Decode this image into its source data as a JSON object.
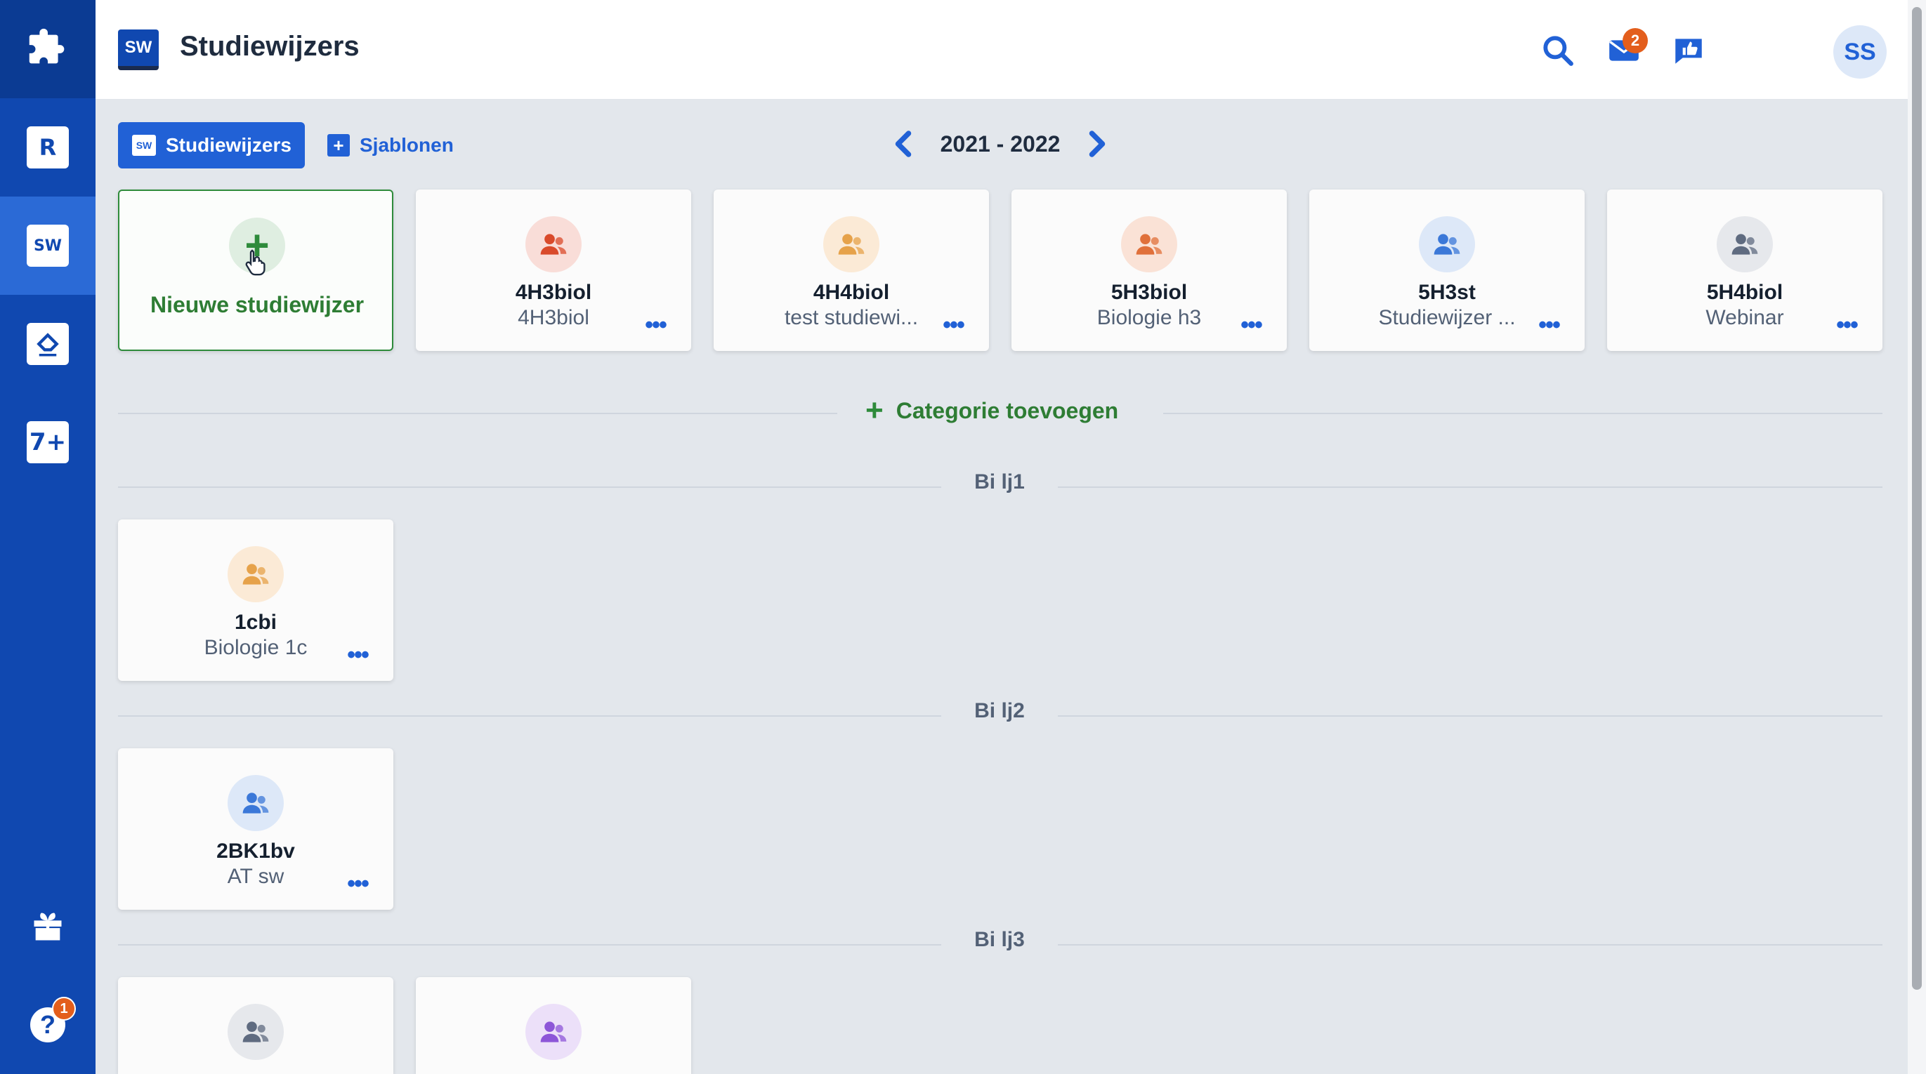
{
  "sidebar": {
    "items": [
      {
        "name": "puzzle",
        "label": ""
      },
      {
        "name": "rooster",
        "label": "R"
      },
      {
        "name": "studiewijzers",
        "label": "SW"
      },
      {
        "name": "inleveren",
        "label": ""
      },
      {
        "name": "cijfers",
        "label": "7+"
      }
    ],
    "help_badge": "1"
  },
  "header": {
    "logo": "SW",
    "title": "Studiewijzers",
    "mail_badge": "2",
    "avatar_initials": "SS"
  },
  "toolbar": {
    "tab_studiewijzers": "Studiewijzers",
    "tab_studiewijzers_icon": "SW",
    "tab_sjablonen": "Sjablonen",
    "year": "2021 - 2022"
  },
  "top_cards": {
    "new_label": "Nieuwe studiewijzer",
    "items": [
      {
        "code": "4H3biol",
        "name": "4H3biol",
        "color": "#d94a2b"
      },
      {
        "code": "4H4biol",
        "name": "test studiewi...",
        "color": "#e6a24a"
      },
      {
        "code": "5H3biol",
        "name": "Biologie h3",
        "color": "#e0703a"
      },
      {
        "code": "5H3st",
        "name": "Studiewijzer ...",
        "color": "#3b78d8"
      },
      {
        "code": "5H4biol",
        "name": "Webinar",
        "color": "#5f6b80"
      }
    ]
  },
  "category_add": "Categorie toevoegen",
  "more_label": "•••",
  "categories": [
    {
      "title": "Bi lj1",
      "cards": [
        {
          "code": "1cbi",
          "name": "Biologie 1c",
          "color": "#e6a24a"
        }
      ]
    },
    {
      "title": "Bi lj2",
      "cards": [
        {
          "code": "2BK1bv",
          "name": "AT sw",
          "color": "#3b78d8"
        }
      ]
    },
    {
      "title": "Bi lj3",
      "cards": [
        {
          "code": "",
          "name": "",
          "color": "#5f6b80"
        },
        {
          "code": "",
          "name": "",
          "color": "#8d56d8"
        }
      ]
    }
  ]
}
